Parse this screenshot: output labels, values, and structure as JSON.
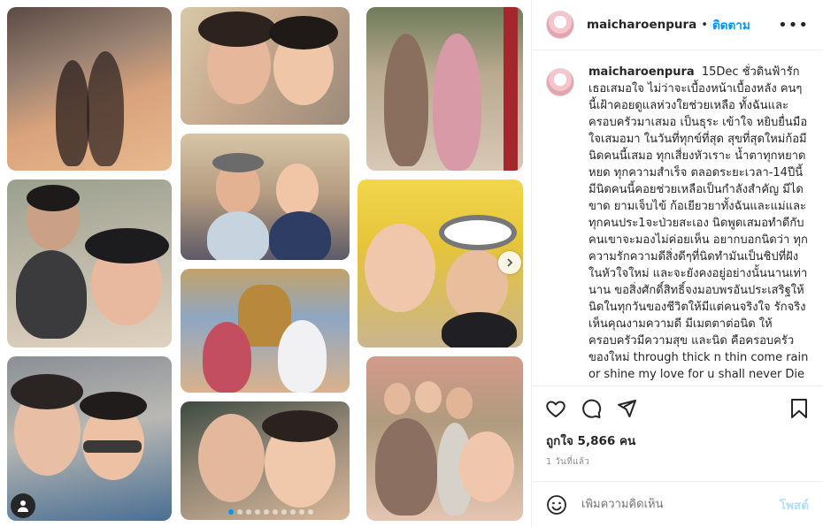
{
  "post": {
    "username": "maicharoenpura",
    "separator": "•",
    "follow_label": "ติดตาม",
    "more_icon": "more-horizontal-icon"
  },
  "caption": {
    "username": "maicharoenpura",
    "text": "15Dec ชั่วดินฟ้ารักเธอเสมอใจ ไม่ว่าจะเบื้องหน้าเบื้องหลัง คนๆนี้เฝ้าคอยดูแลห่วงใยช่วยเหลือ ทั้งฉันและครอบครัวมาเสมอ เป็นธุระ เข้าใจ หยิบยื่นมือใจเสมอมา ในวันที่ทุกข์ที่สุด สุขที่สุดใหม่ก้อมีนิดคนนี้เสมอ ทุกเสี่ยงหัวเราะ น้ำตาทุกหยาดหยด ทุกความสำเร็จ ตลอดระยะเวลา-14ปีนี้ มีนิดคนนี้คอยช่วยเหลือเป็นกำลังสำคัญ มีไดขาด ยามเจ็บไข้ ก้อเยียวยาทั้งฉันและแม่และทุกคนประ1จะป่วยสะเอง นิดพูดเสมอทำดีกับคนเขาจะมองไม่ค่อยเห็น อยากบอกนิดว่า ทุกความรักความดีสิ่งดีๆที่นิดทำมันเป็นชิปที่ฝังในหัวใจใหม่ และจะยังคงอยู่อย่างนั้นนานเท่านาน ขอสิ่งศักดิ์สิทธิ์จงมอบพรอันประเสริฐให้นิดในทุกวันของชีวิตให้มีแต่คนจริงใจ รักจริงเห็นคุณงามความดี มีเมตตาต่อนิด ให้ครอบครัวมีความสุข และนิด คือครอบครัวของใหม่ through thick n thin come rain or shine my love for u shall never Die"
  },
  "actions": {
    "like_icon": "heart-icon",
    "comment_icon": "comment-icon",
    "share_icon": "share-icon",
    "save_icon": "bookmark-icon"
  },
  "stats": {
    "likes_text": "ถูกใจ 5,866 คน",
    "time_ago": "1 วันที่แล้ว"
  },
  "comment": {
    "placeholder": "เพิ่มความคิดเห็น",
    "post_label": "โพสต์",
    "emoji_icon": "emoji-icon"
  },
  "carousel": {
    "slide_count": 10,
    "active_index": 0,
    "next_icon": "chevron-right-icon",
    "tag_icon": "user-tag-icon"
  },
  "colors": {
    "accent": "#0095f6",
    "post_disabled": "#b2dffc",
    "text": "#262626",
    "muted": "#8e8e8e"
  }
}
